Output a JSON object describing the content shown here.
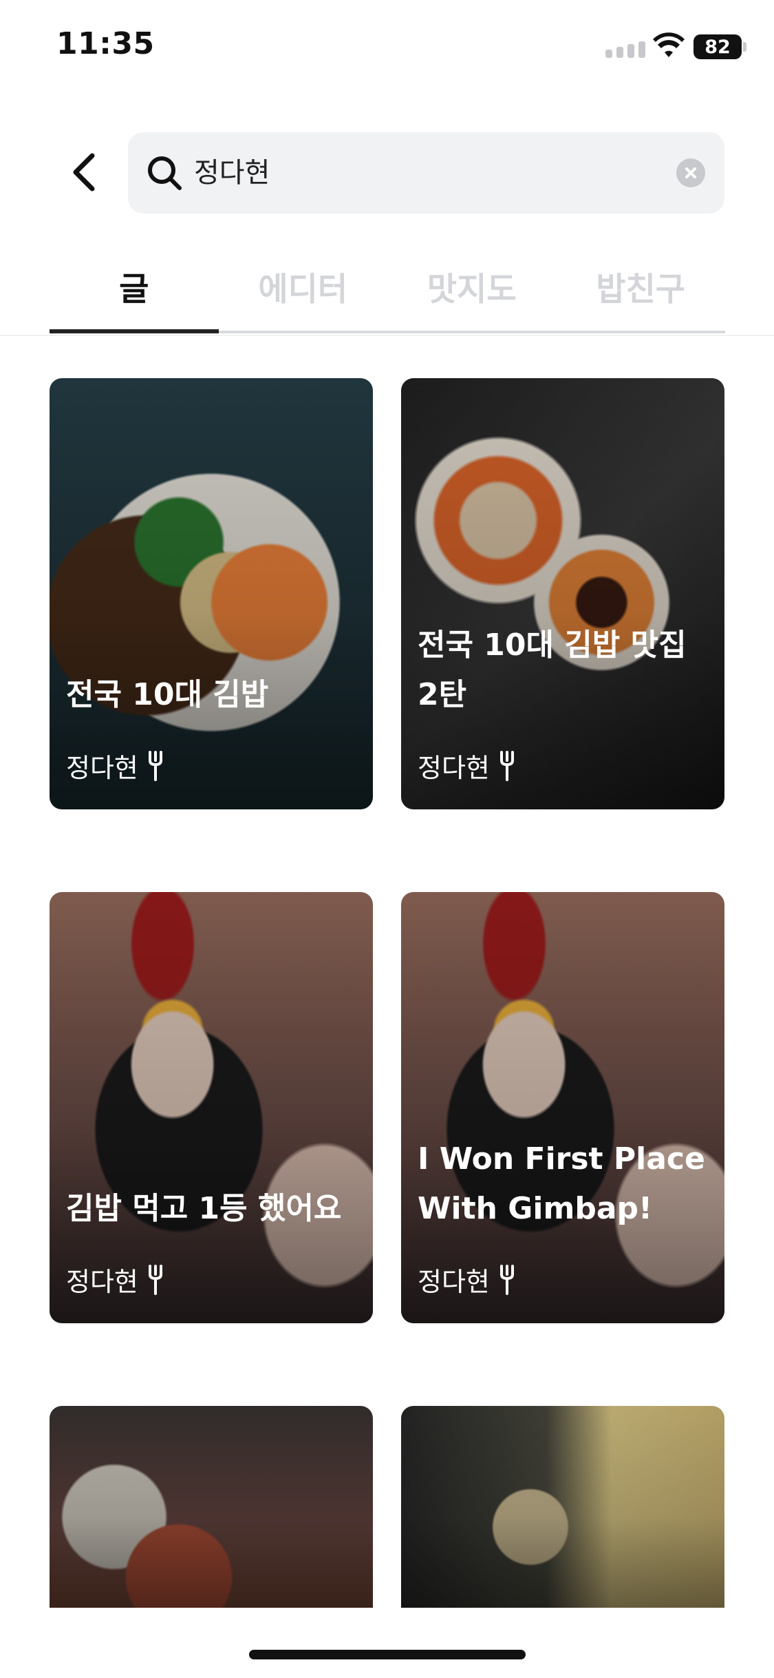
{
  "status_bar": {
    "time": "11:35",
    "battery": "82"
  },
  "search": {
    "query": "정다현",
    "back_icon": "chevron-left-icon",
    "search_icon": "search-icon",
    "clear_icon": "close-circle-icon"
  },
  "tabs": [
    {
      "label": "글",
      "active": true
    },
    {
      "label": "에디터",
      "active": false
    },
    {
      "label": "맛지도",
      "active": false
    },
    {
      "label": "밥친구",
      "active": false
    }
  ],
  "cards": [
    {
      "title": "전국 10대 김밥",
      "author": "정다현"
    },
    {
      "title": "전국 10대 김밥 맛집 2탄",
      "author": "정다현"
    },
    {
      "title": "김밥 먹고 1등 했어요",
      "author": "정다현"
    },
    {
      "title": "I Won First Place With Gimbap!",
      "author": "정다현"
    }
  ]
}
